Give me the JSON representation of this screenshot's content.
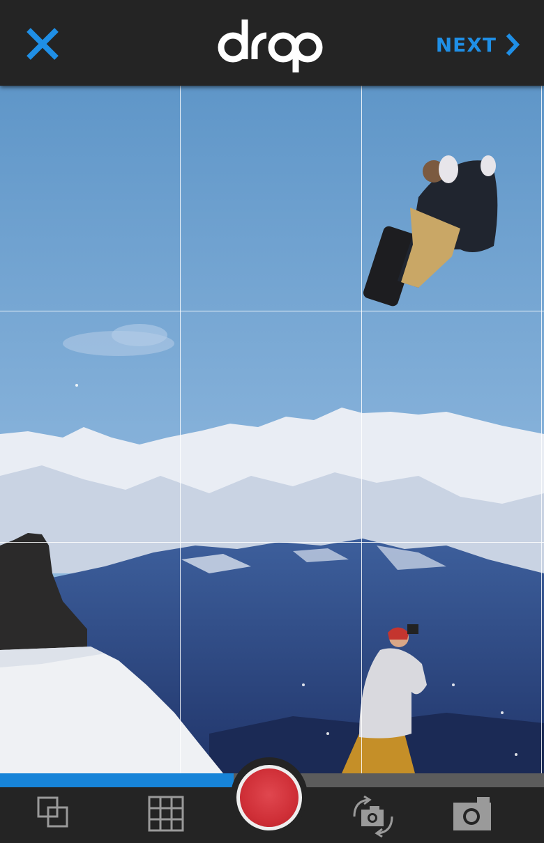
{
  "app": {
    "logo_text": "drop",
    "brand_color": "#1f8fe6"
  },
  "topbar": {
    "close_icon": "close-icon",
    "next_label": "NEXT",
    "next_icon": "chevron-right-icon"
  },
  "recording": {
    "progress": 0.43,
    "progress_color": "#1784d8",
    "record_color": "#d0333b"
  },
  "toolbar": {
    "items": [
      {
        "name": "overlay-icon"
      },
      {
        "name": "grid-icon"
      },
      {
        "name": "record-button"
      },
      {
        "name": "switch-camera-icon"
      },
      {
        "name": "camera-icon"
      }
    ]
  }
}
